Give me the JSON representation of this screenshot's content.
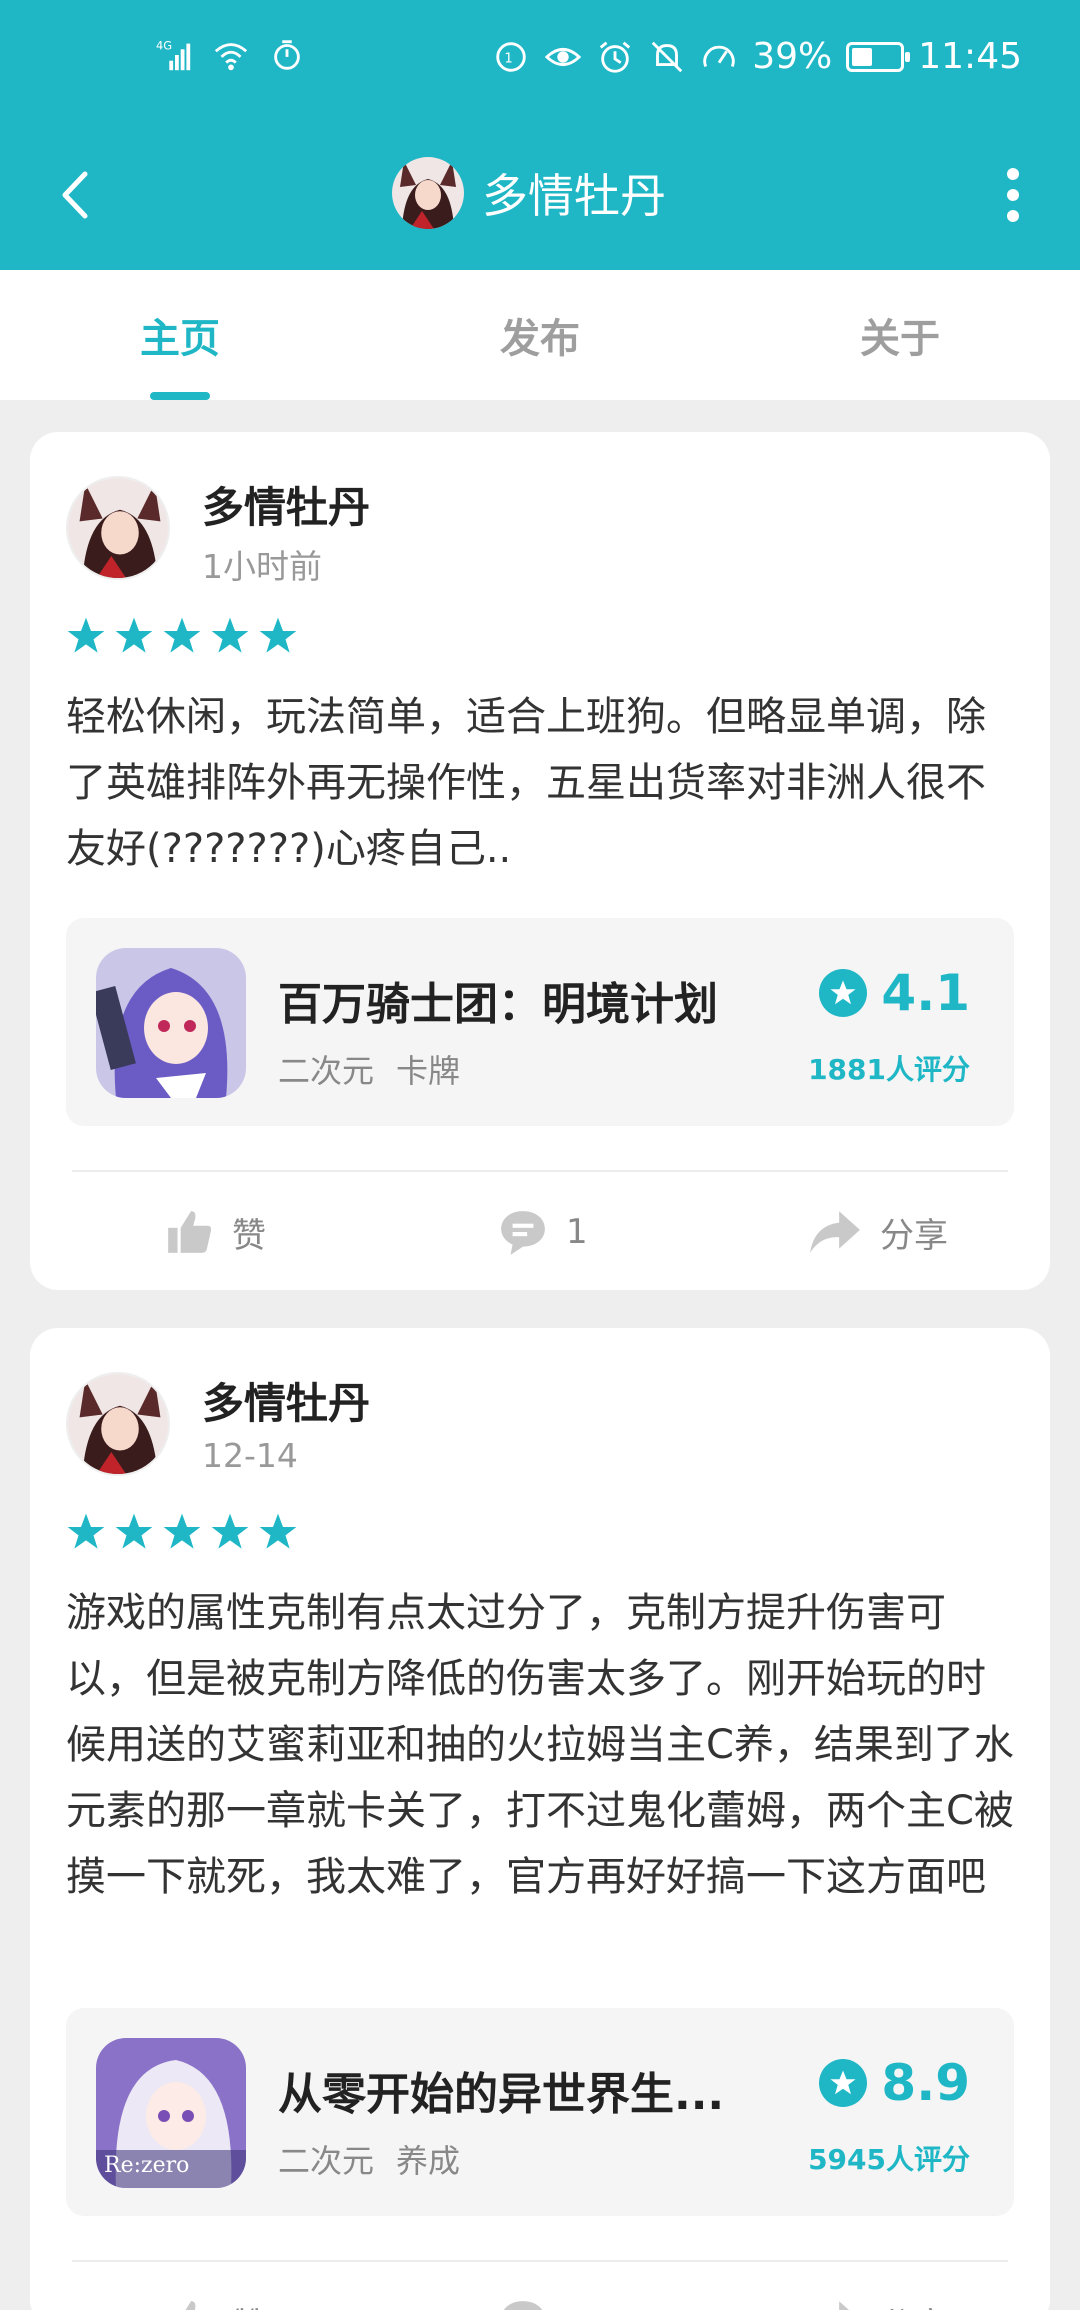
{
  "status_bar": {
    "network": "4G",
    "battery": "39%",
    "battery_level": 0.39,
    "time": "11:45"
  },
  "header": {
    "title": "多情牡丹",
    "back_icon": "chevron-left-icon",
    "more_icon": "more-vertical-icon"
  },
  "tabs": [
    {
      "label": "主页",
      "active": true
    },
    {
      "label": "发布",
      "active": false
    },
    {
      "label": "关于",
      "active": false
    }
  ],
  "colors": {
    "accent": "#1fb7c6",
    "background": "#eeeeee"
  },
  "posts": [
    {
      "user": "多情牡丹",
      "time": "1小时前",
      "stars": 5,
      "text": "轻松休闲，玩法简单，适合上班狗。但略显单调，除了英雄排阵外再无操作性，五星出货率对非洲人很不友好(???????)心疼自己..",
      "game": {
        "name": "百万骑士团：明境计划",
        "tags": [
          "二次元",
          "卡牌"
        ],
        "score": "4.1",
        "count": "1881人评分"
      },
      "actions": {
        "like": "赞",
        "comment": "1",
        "share": "分享"
      }
    },
    {
      "user": "多情牡丹",
      "time": "12-14",
      "stars": 5,
      "text": "游戏的属性克制有点太过分了，克制方提升伤害可以，但是被克制方降低的伤害太多了。刚开始玩的时候用送的艾蜜莉亚和抽的火拉姆当主C养，结果到了水元素的那一章就卡关了，打不过鬼化蕾姆，两个主C被摸一下就死，我太难了，官方再好好搞一下这方面吧",
      "game": {
        "name": "从零开始的异世界生...",
        "tags": [
          "二次元",
          "养成"
        ],
        "score": "8.9",
        "count": "5945人评分"
      },
      "actions": {
        "like": "赞",
        "comment": "",
        "share": "分享"
      }
    }
  ]
}
